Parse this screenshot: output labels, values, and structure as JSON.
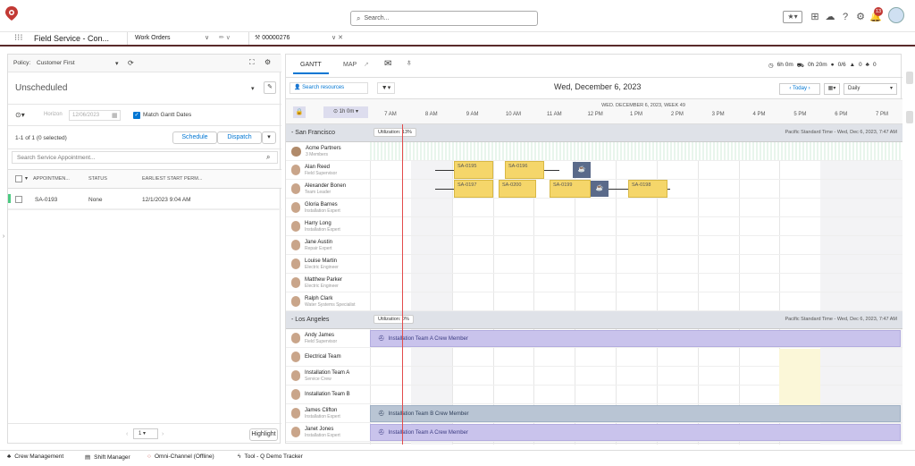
{
  "header": {
    "search_placeholder": "Search...",
    "notifications_count": "13"
  },
  "nav": {
    "app_name": "Field Service - Con...",
    "tabs": [
      {
        "label": "Work Orders"
      },
      {
        "label": "00000276"
      }
    ]
  },
  "left": {
    "policy_label": "Policy:",
    "policy_value": "Customer First",
    "list_title": "Unscheduled",
    "horizon_label": "Horizon",
    "horizon_date": "12/06/2023",
    "match_gantt": "Match Gantt Dates",
    "count_text": "1-1 of 1 (0 selected)",
    "schedule_btn": "Schedule",
    "dispatch_btn": "Dispatch",
    "search_placeholder": "Search Service Appointment...",
    "columns": [
      "APPOINTMEN...",
      "STATUS",
      "EARLIEST START PERM..."
    ],
    "rows": [
      {
        "id": "SA-0193",
        "status": "None",
        "start": "12/1/2023 9:04 AM"
      }
    ],
    "page_num": "1",
    "highlight_btn": "Highlight"
  },
  "gantt": {
    "tabs": [
      "GANTT",
      "MAP"
    ],
    "kpis": {
      "time1": "6h 0m",
      "time2": "0h 20m",
      "ratio": "0/6",
      "warnings": "0",
      "alerts": "0"
    },
    "search_resources": "Search resources",
    "date_title": "Wed, December 6, 2023",
    "today_btn": "Today",
    "view_select": "Daily",
    "zoom_label": "1h 0m",
    "week_label": "WED. DECEMBER 6, 2023, WEEK 49",
    "hours": [
      "7 AM",
      "8 AM",
      "9 AM",
      "10 AM",
      "11 AM",
      "12 PM",
      "1 PM",
      "2 PM",
      "3 PM",
      "4 PM",
      "5 PM",
      "6 PM",
      "7 PM"
    ],
    "groups": [
      {
        "name": "- San Francisco",
        "utilization": "Utilization: 13%",
        "timezone": "Pacific Standard Time - Wed, Dec 6, 2023, 7:47 AM"
      },
      {
        "name": "- Los Angeles",
        "utilization": "Utilization: 0%",
        "timezone": "Pacific Standard Time - Wed, Dec 6, 2023, 7:47 AM"
      }
    ],
    "sf_resources": [
      {
        "name": "Acme Partners",
        "role": "3 Members"
      },
      {
        "name": "Alan Reed",
        "role": "Field Supervisor"
      },
      {
        "name": "Alexander Bonen",
        "role": "Team Leader"
      },
      {
        "name": "Gloria Barnes",
        "role": "Installation Expert"
      },
      {
        "name": "Harry Long",
        "role": "Installation Expert"
      },
      {
        "name": "Jane Austin",
        "role": "Repair Expert"
      },
      {
        "name": "Louise Martin",
        "role": "Electric Engineer"
      },
      {
        "name": "Matthew Parker",
        "role": "Electric Engineer"
      },
      {
        "name": "Ralph Clark",
        "role": "Water Systems Specialist"
      }
    ],
    "la_resources": [
      {
        "name": "Andy James",
        "role": "Field Supervisor"
      },
      {
        "name": "Electrical Team",
        "role": ""
      },
      {
        "name": "Installation Team A",
        "role": "Service Crew"
      },
      {
        "name": "Installation Team B",
        "role": ""
      },
      {
        "name": "James Clifton",
        "role": "Installation Expert"
      },
      {
        "name": "Janet Jones",
        "role": "Installation Expert"
      }
    ],
    "appointments": [
      "SA-0195",
      "SA-0196",
      "SA-0197",
      "SA-0200",
      "SA-0199",
      "SA-0198"
    ],
    "crew_bars": [
      "Installation Team A Crew Member",
      "Installation Team B Crew Member",
      "Installation Team A Crew Member"
    ]
  },
  "footer": {
    "items": [
      "Crew Management",
      "Shift Manager",
      "Omni-Channel (Offline)",
      "Tool - Q Demo Tracker"
    ]
  },
  "colors": {
    "accent": "#0176d3",
    "appointment": "#f5d66a",
    "crew": "#c9c3ec",
    "now_line": "#e34b4b",
    "brand": "#c23934"
  }
}
